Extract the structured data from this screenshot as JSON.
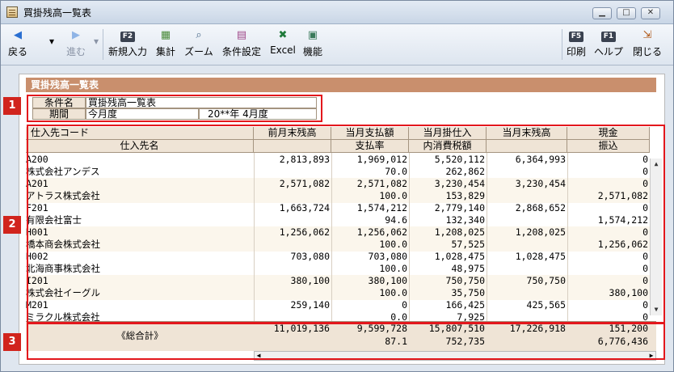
{
  "window": {
    "title": "買掛残高一覧表"
  },
  "toolbar": {
    "back": "戻る",
    "forward": "進む",
    "new_entry": "新規入力",
    "total": "集計",
    "zoom": "ズーム",
    "conditions": "条件設定",
    "excel": "Excel",
    "functions": "機能",
    "print_key": "F5",
    "print": "印刷",
    "help_key": "F1",
    "help": "ヘルプ",
    "close": "閉じる",
    "new_entry_key": "F2"
  },
  "section": {
    "title": "買掛残高一覧表"
  },
  "conditions": {
    "name_label": "条件名",
    "name_value": "買掛残高一覧表",
    "period_label": "期間",
    "period_value": "今月度",
    "period_month": "20**年 4月度"
  },
  "table": {
    "headers_top": [
      "仕入先コード",
      "前月末残高",
      "当月支払額",
      "当月掛仕入",
      "当月末残高",
      "現金"
    ],
    "headers_bottom": [
      "仕入先名",
      "",
      "支払率",
      "内消費税額",
      "",
      "振込"
    ],
    "rows": [
      {
        "code": "A200",
        "name": "株式会社アンデス",
        "prev": "2,813,893",
        "paid": "1,969,012",
        "rate": "70.0",
        "purchase": "5,520,112",
        "tax": "262,862",
        "end": "6,364,993",
        "cash": "0",
        "transfer": "0"
      },
      {
        "code": "A201",
        "name": "アトラス株式会社",
        "prev": "2,571,082",
        "paid": "2,571,082",
        "rate": "100.0",
        "purchase": "3,230,454",
        "tax": "153,829",
        "end": "3,230,454",
        "cash": "0",
        "transfer": "2,571,082"
      },
      {
        "code": "F201",
        "name": "有限会社富士",
        "prev": "1,663,724",
        "paid": "1,574,212",
        "rate": "94.6",
        "purchase": "2,779,140",
        "tax": "132,340",
        "end": "2,868,652",
        "cash": "0",
        "transfer": "1,574,212"
      },
      {
        "code": "H001",
        "name": "橋本商会株式会社",
        "prev": "1,256,062",
        "paid": "1,256,062",
        "rate": "100.0",
        "purchase": "1,208,025",
        "tax": "57,525",
        "end": "1,208,025",
        "cash": "0",
        "transfer": "1,256,062"
      },
      {
        "code": "H002",
        "name": "北海商事株式会社",
        "prev": "703,080",
        "paid": "703,080",
        "rate": "100.0",
        "purchase": "1,028,475",
        "tax": "48,975",
        "end": "1,028,475",
        "cash": "0",
        "transfer": "0"
      },
      {
        "code": "I201",
        "name": "株式会社イーグル",
        "prev": "380,100",
        "paid": "380,100",
        "rate": "100.0",
        "purchase": "750,750",
        "tax": "35,750",
        "end": "750,750",
        "cash": "0",
        "transfer": "380,100"
      },
      {
        "code": "M201",
        "name": "ミラクル株式会社",
        "prev": "259,140",
        "paid": "0",
        "rate": "0.0",
        "purchase": "166,425",
        "tax": "7,925",
        "end": "425,565",
        "cash": "0",
        "transfer": "0"
      }
    ]
  },
  "totals": {
    "label": "《総合計》",
    "prev": "11,019,136",
    "paid": "9,599,728",
    "rate": "87.1",
    "purchase": "15,807,510",
    "tax": "752,735",
    "end": "17,226,918",
    "cash": "151,200",
    "transfer": "6,776,436"
  },
  "badges": [
    "1",
    "2",
    "3"
  ],
  "colors": {
    "annotation_red": "#e3171c",
    "section_brown": "#c98f6d"
  }
}
